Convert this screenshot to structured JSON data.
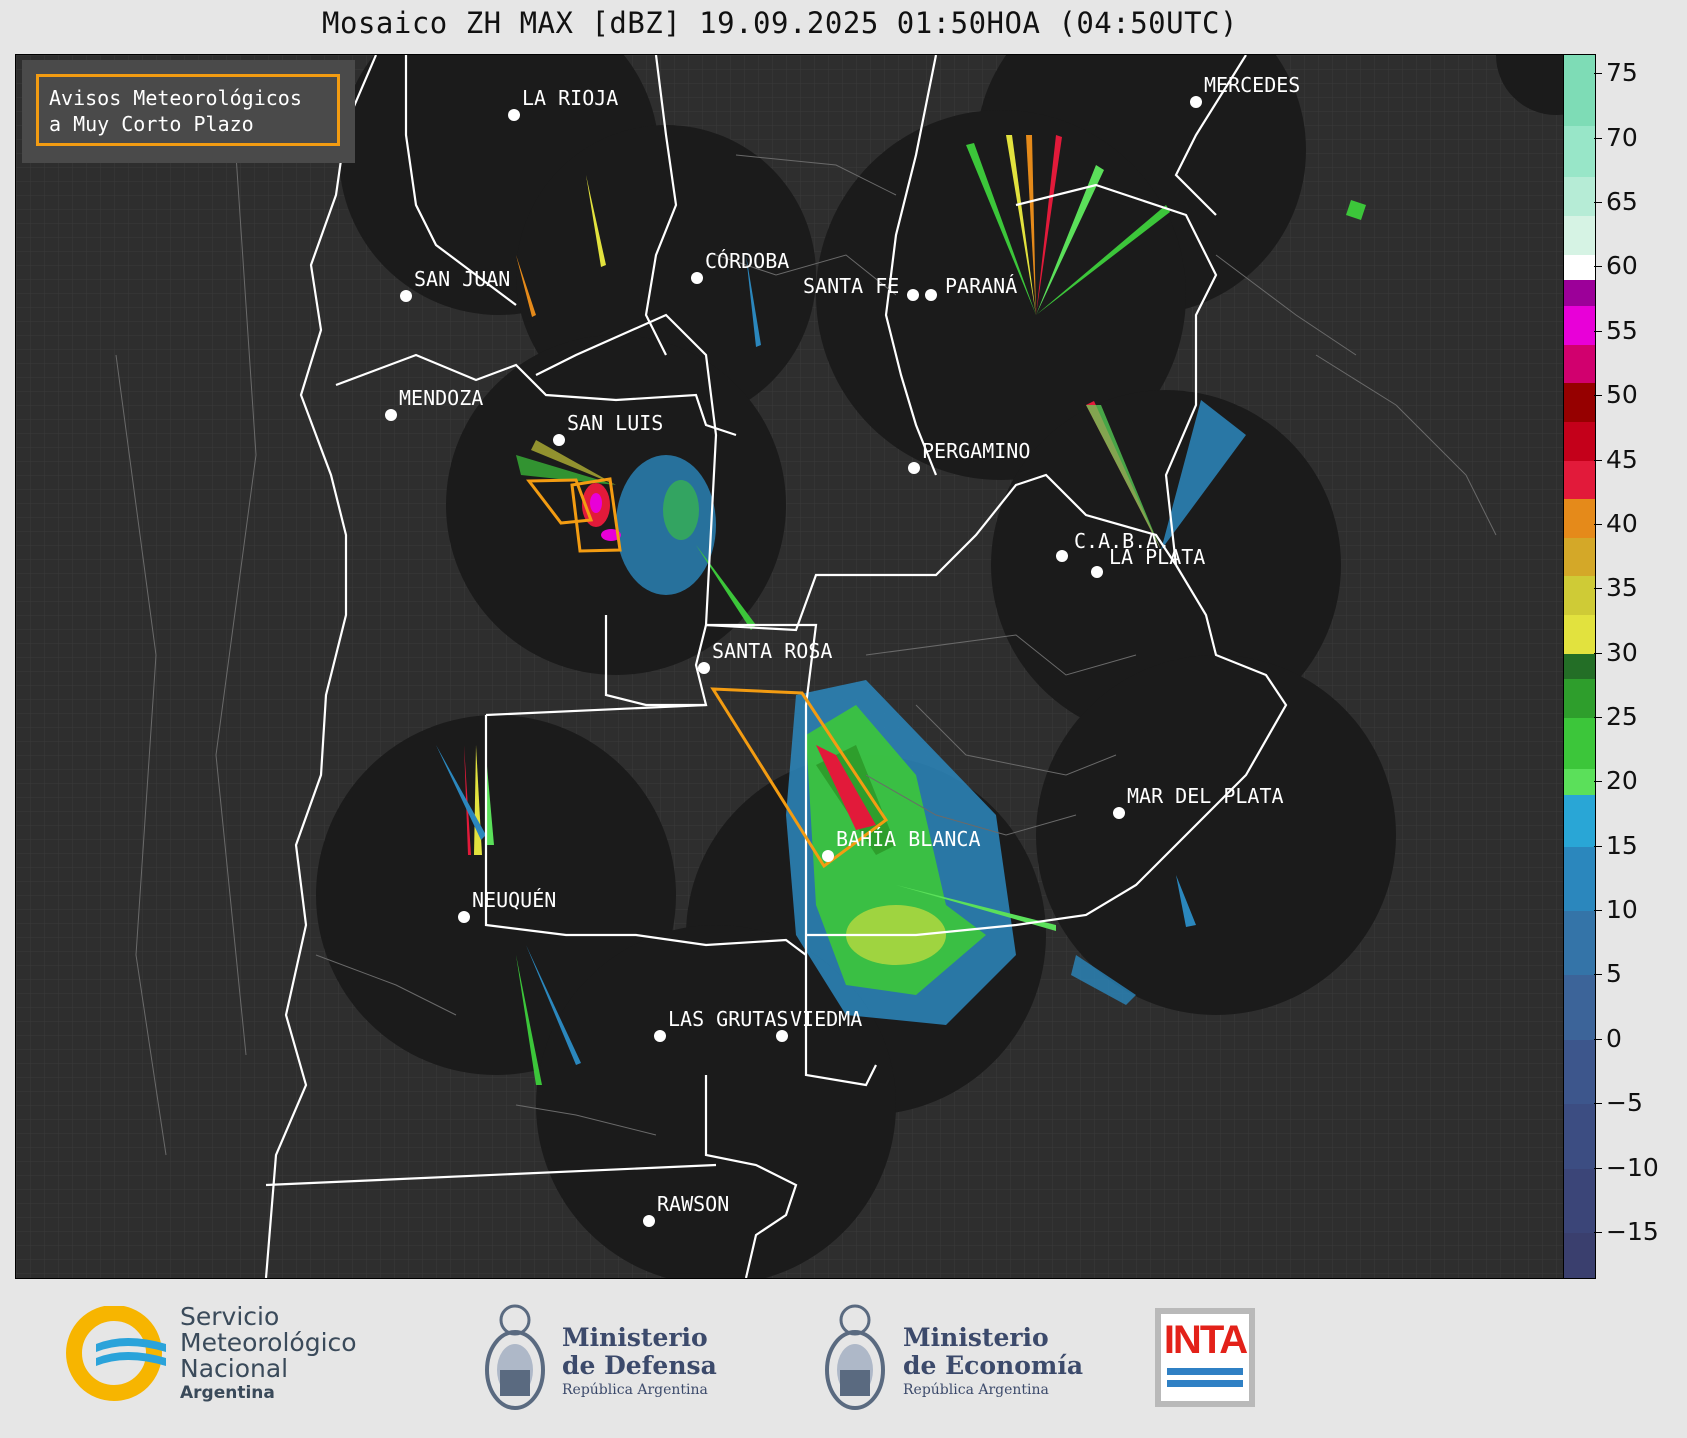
{
  "title": "Mosaico ZH MAX [dBZ] 19.09.2025 01:50HOA (04:50UTC)",
  "warning_legend": {
    "line1": "Avisos Meteorológicos",
    "line2": "a Muy Corto Plazo",
    "color": "#f39c12"
  },
  "cities": [
    "LA RIOJA",
    "MERCEDES",
    "CÓRDOBA",
    "SAN JUAN",
    "SANTA FE",
    "PARANÁ",
    "MENDOZA",
    "SAN LUIS",
    "PERGAMINO",
    "C.A.B.A.",
    "LA PLATA",
    "SANTA ROSA",
    "MAR DEL PLATA",
    "BAHÍA BLANCA",
    "NEUQUÉN",
    "LAS GRUTAS",
    "VIEDMA",
    "RAWSON"
  ],
  "colorbar": {
    "unit": "dBZ",
    "ticks": [
      "75",
      "70",
      "65",
      "60",
      "55",
      "50",
      "45",
      "40",
      "35",
      "30",
      "25",
      "20",
      "15",
      "10",
      "5",
      "0",
      "−5",
      "−10",
      "−15"
    ],
    "range": [
      -18.5,
      76.5
    ],
    "bands": [
      {
        "from": -20,
        "to": -15,
        "color": "#3a3f6e"
      },
      {
        "from": -15,
        "to": -10,
        "color": "#3b4578"
      },
      {
        "from": -10,
        "to": -5,
        "color": "#3c4d82"
      },
      {
        "from": -5,
        "to": 0,
        "color": "#3d568c"
      },
      {
        "from": 0,
        "to": 5,
        "color": "#3c6499"
      },
      {
        "from": 5,
        "to": 10,
        "color": "#3474a8"
      },
      {
        "from": 10,
        "to": 15,
        "color": "#2b87bd"
      },
      {
        "from": 15,
        "to": 19,
        "color": "#29a6d6"
      },
      {
        "from": 19,
        "to": 21,
        "color": "#5be05a"
      },
      {
        "from": 21,
        "to": 25,
        "color": "#3cc63a"
      },
      {
        "from": 25,
        "to": 28,
        "color": "#2e9e2c"
      },
      {
        "from": 28,
        "to": 30,
        "color": "#236e26"
      },
      {
        "from": 30,
        "to": 33,
        "color": "#e2e23e"
      },
      {
        "from": 33,
        "to": 36,
        "color": "#cfcb36"
      },
      {
        "from": 36,
        "to": 39,
        "color": "#d4a828"
      },
      {
        "from": 39,
        "to": 42,
        "color": "#e58a1a"
      },
      {
        "from": 42,
        "to": 45,
        "color": "#e21a3a"
      },
      {
        "from": 45,
        "to": 48,
        "color": "#c4001a"
      },
      {
        "from": 48,
        "to": 51,
        "color": "#960000"
      },
      {
        "from": 51,
        "to": 54,
        "color": "#d1006e"
      },
      {
        "from": 54,
        "to": 57,
        "color": "#e800d8"
      },
      {
        "from": 57,
        "to": 59,
        "color": "#9c0099"
      },
      {
        "from": 59,
        "to": 61,
        "color": "#ffffff"
      },
      {
        "from": 61,
        "to": 64,
        "color": "#d6f3e4"
      },
      {
        "from": 64,
        "to": 67,
        "color": "#b6ecd6"
      },
      {
        "from": 67,
        "to": 71,
        "color": "#98e6c8"
      },
      {
        "from": 71,
        "to": 77,
        "color": "#7edcb6"
      }
    ]
  },
  "footer": {
    "smn": {
      "l1": "Servicio",
      "l2": "Meteorológico",
      "l3": "Nacional",
      "l4": "Argentina"
    },
    "defensa": {
      "l1": "Ministerio",
      "l2": "de Defensa",
      "l3": "República Argentina"
    },
    "economia": {
      "l1": "Ministerio",
      "l2": "de Economía",
      "l3": "República Argentina"
    },
    "inta": "INTA"
  }
}
